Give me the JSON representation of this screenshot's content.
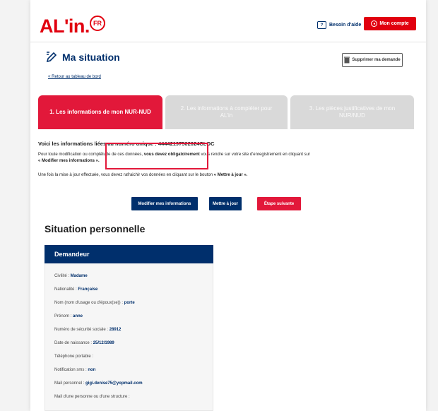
{
  "header": {
    "logo_text": "AL'in.",
    "logo_badge": "FR",
    "help_icon": "chat-question-icon",
    "help_label": "Besoin d'aide",
    "account_label": "Mon compte",
    "account_icon": "user-circle-icon"
  },
  "title": {
    "icon": "edit-pencil-icon",
    "text": "Ma situation",
    "back_link": "< Retour au tableau de bord",
    "delete_label": "Supprimer ma demande",
    "delete_icon": "trash-icon"
  },
  "steps": [
    {
      "label": "1. Les informations de mon NUR-NUD"
    },
    {
      "label": "2. Les informations à compléter pour AL'in"
    },
    {
      "label": "3. Les pièces justificatives de mon NUR/NUD"
    }
  ],
  "intro": {
    "title": "Voici les informations liées au numéro unique : 44442197502024CLOC",
    "p1_plain_1": "Pour toute modification ou complétude de ces données, ",
    "p1_bold_1": "vous devez obligatoirement",
    "p1_plain_2": " vous rendre sur votre site d'enregistrement en cliquant sur ",
    "p1_bold_2": "« Modifier mes informations ».",
    "p2_plain": "Une fois la mise à jour effectuée, vous devez rafraichir vos données en cliquant sur le bouton ",
    "p2_bold": "« Mettre à jour »."
  },
  "actions": {
    "modify_label": "Modifier mes informations",
    "update_label": "Mettre à jour",
    "next_label": "Étape suivante"
  },
  "situation": {
    "section_title": "Situation personnelle",
    "panel_title": "Demandeur",
    "fields": [
      {
        "label": "Civilité : ",
        "value": "Madame"
      },
      {
        "label": "Nationalité : ",
        "value": "Française"
      },
      {
        "label": "Nom (nom d'usage ou d'époux(se)) : ",
        "value": "porte"
      },
      {
        "label": "Prénom : ",
        "value": "anne"
      },
      {
        "label": "Numéro de sécurité sociale : ",
        "value": "28912"
      },
      {
        "label": "Date de naissance : ",
        "value": "25/12/1989"
      },
      {
        "label": "Téléphone portable : ",
        "value": ""
      },
      {
        "label": "Notification sms : ",
        "value": "non"
      },
      {
        "label": "Mail personnel : ",
        "value": "gigi.denise75@yopmail.com"
      },
      {
        "label": "Mail d'une personne ou d'une structure : ",
        "value": ""
      }
    ]
  },
  "colors": {
    "brand_red": "#e1000f",
    "navy": "#002f6c",
    "step_active": "#e2183a",
    "step_inactive": "#d9d9d9"
  }
}
